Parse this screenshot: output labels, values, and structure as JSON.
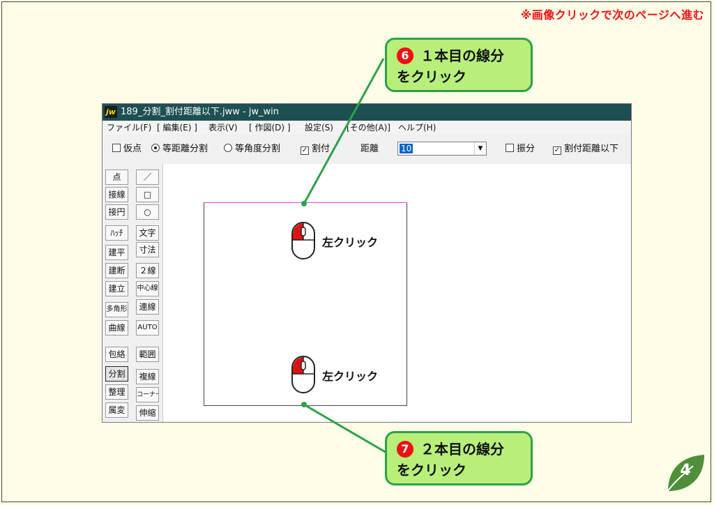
{
  "top_note": "※画像クリックで次のページへ進む",
  "callout_top": {
    "num": "6",
    "line1": "１本目の線分",
    "line2": "をクリック"
  },
  "callout_bottom": {
    "num": "7",
    "line1": "２本目の線分",
    "line2": "をクリック"
  },
  "window": {
    "title": "189_分割_割付距離以下.jww - jw_win",
    "icon": "jw"
  },
  "menu": [
    "ファイル(F)",
    "[ 編集(E) ]",
    "表示(V)",
    "[ 作図(D) ]",
    "設定(S)",
    "[その他(A)]",
    "ヘルプ(H)"
  ],
  "toolbar": {
    "karaten": "仮点",
    "tou_kyori": "等距離分割",
    "tou_kakudo": "等角度分割",
    "waritsuke": "割付",
    "kyori_label": "距離",
    "kyori_value": "10",
    "furibun": "振分",
    "waritsuke_ika": "割付距離以下"
  },
  "sidebar_col1": [
    "点",
    "接線",
    "接円",
    "ﾊｯﾁ",
    "建平",
    "建断",
    "建立",
    "多角形",
    "曲線",
    "包絡",
    "分割",
    "整理",
    "属変"
  ],
  "sidebar_col2": [
    "／",
    "□",
    "○",
    "文字",
    "寸法",
    "２線",
    "中心線",
    "連線",
    "AUTO",
    "範囲",
    "複線",
    "コーナー",
    "伸縮"
  ],
  "left_click_label": "左クリック",
  "page_number": "4",
  "colors": {
    "accent_green": "#2ea04a",
    "callout_fill": "#b8ef7a",
    "title_bar": "#1e4f52",
    "note_red": "#ee1111",
    "mouse_red": "#dd1111"
  },
  "icons": {
    "mouse": "mouse-left-click-icon",
    "leaf": "leaf-icon"
  }
}
